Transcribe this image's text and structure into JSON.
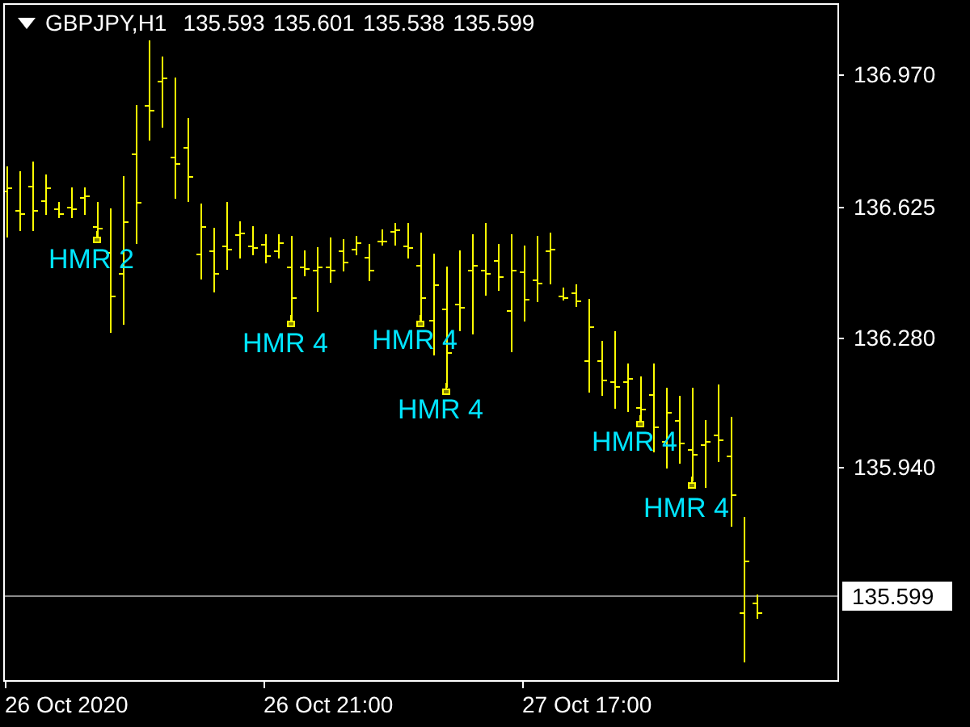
{
  "header": {
    "symbol": "GBPJPY,H1",
    "values": [
      "135.593",
      "135.601",
      "135.538",
      "135.599"
    ]
  },
  "price_axis": {
    "labels": [
      "136.970",
      "136.625",
      "136.280",
      "135.940"
    ],
    "current_price": "135.599"
  },
  "time_axis": {
    "labels": [
      "26 Oct 2020",
      "26 Oct 21:00",
      "27 Oct 17:00"
    ]
  },
  "signals": [
    {
      "label": "HMR 2"
    },
    {
      "label": "HMR 4"
    },
    {
      "label": "HMR 4"
    },
    {
      "label": "HMR 4"
    },
    {
      "label": "HMR 4"
    },
    {
      "label": "HMR 4"
    }
  ]
}
